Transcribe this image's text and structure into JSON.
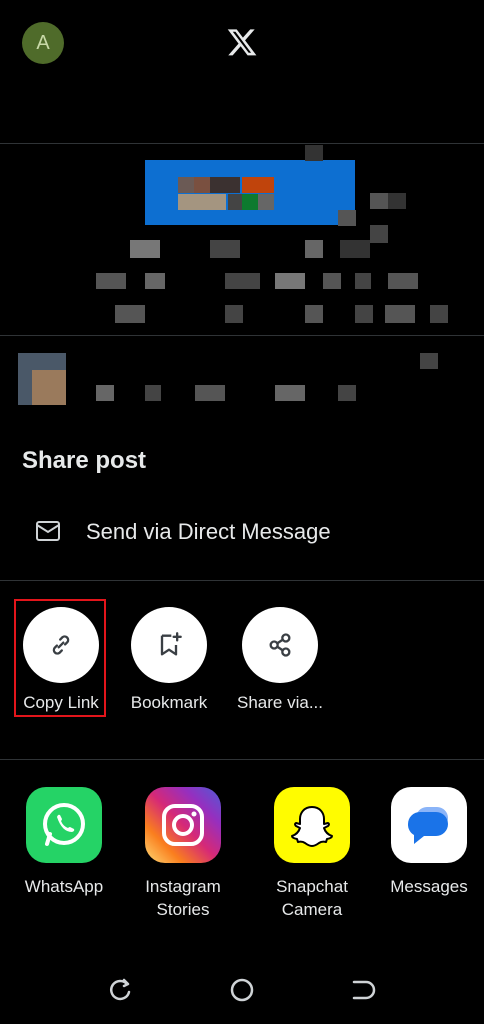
{
  "topbar": {
    "avatar_letter": "A"
  },
  "sheet": {
    "title": "Share post",
    "direct_message_label": "Send via Direct Message",
    "actions": [
      {
        "label": "Copy Link",
        "icon": "link-icon"
      },
      {
        "label": "Bookmark",
        "icon": "bookmark-add-icon"
      },
      {
        "label": "Share via...",
        "icon": "share-icon"
      }
    ],
    "apps": [
      {
        "label": "WhatsApp",
        "icon": "whatsapp-icon"
      },
      {
        "label": "Instagram Stories",
        "icon": "instagram-icon"
      },
      {
        "label": "Snapchat Camera",
        "icon": "snapchat-icon"
      },
      {
        "label": "Messages",
        "icon": "messages-icon"
      }
    ]
  },
  "colors": {
    "background": "#000000",
    "divider": "#2f3336",
    "highlight": "#e3151b",
    "whatsapp": "#25d366",
    "snapchat": "#fffc00",
    "messages": "#1a73e8"
  }
}
